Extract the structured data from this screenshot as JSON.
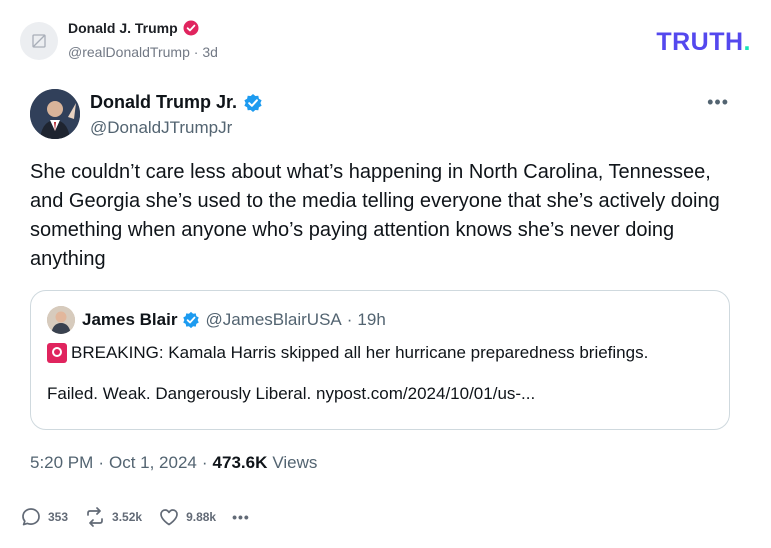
{
  "truth_post": {
    "author_name": "Donald J. Trump",
    "author_handle": "@realDonaldTrump",
    "separator": " · ",
    "age": "3d",
    "logo_text": "TRUTH",
    "logo_dot": ".",
    "brand_color": "#5448ee",
    "verified_color": "#e0245e"
  },
  "embedded_post": {
    "author_name": "Donald Trump Jr.",
    "author_handle": "@DonaldJTrumpJr",
    "more_label": "•••",
    "body": "She couldn’t care less about what’s happening in North Carolina, Tennessee, and Georgia she’s used to the media telling everyone that she’s actively doing something when anyone who’s paying attention knows she’s never doing anything",
    "verified_color": "#1d9bf0",
    "quote": {
      "author_name": "James Blair",
      "author_handle": "@JamesBlairUSA",
      "separator": " · ",
      "age": "19h",
      "line1": "BREAKING: Kamala Harris skipped all her hurricane preparedness briefings.",
      "line2": "Failed. Weak. Dangerously Liberal.  nypost.com/2024/10/01/us-..."
    },
    "meta": {
      "time": "5:20 PM",
      "dot1": "·",
      "date": "Oct 1, 2024",
      "dot2": "·",
      "views_count": "473.6K",
      "views_label": "Views"
    }
  },
  "actions": {
    "replies": "353",
    "retruths": "3.52k",
    "likes": "9.88k",
    "more": "•••"
  }
}
